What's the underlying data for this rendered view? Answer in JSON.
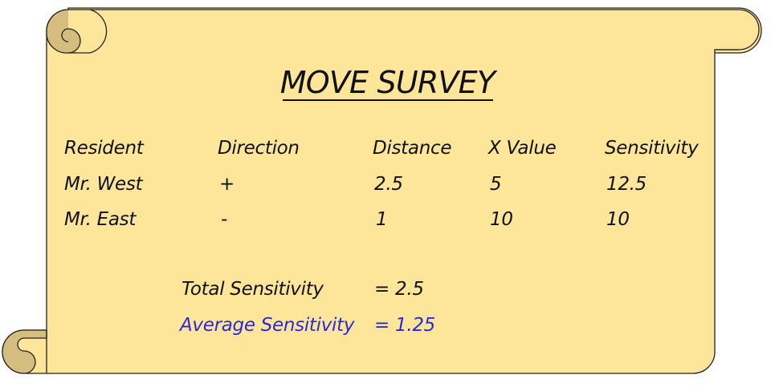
{
  "title": "MOVE SURVEY",
  "table": {
    "headers": [
      "Resident",
      "Direction",
      "Distance",
      "X Value",
      "Sensitivity"
    ],
    "rows": [
      [
        "Mr. West",
        "+",
        "2.5",
        "5",
        "12.5"
      ],
      [
        "Mr. East",
        "-",
        "1",
        "10",
        "10"
      ]
    ]
  },
  "summary": {
    "total_label": "Total Sensitivity",
    "total_value": "= 2.5",
    "average_label": "Average Sensitivity",
    "average_value": "= 1.25"
  },
  "colors": {
    "parchment": "#fde59a",
    "parchment_curl": "#d5bd7e",
    "outline": "#222222",
    "text": "#111111",
    "highlight": "#2b2bd6"
  }
}
